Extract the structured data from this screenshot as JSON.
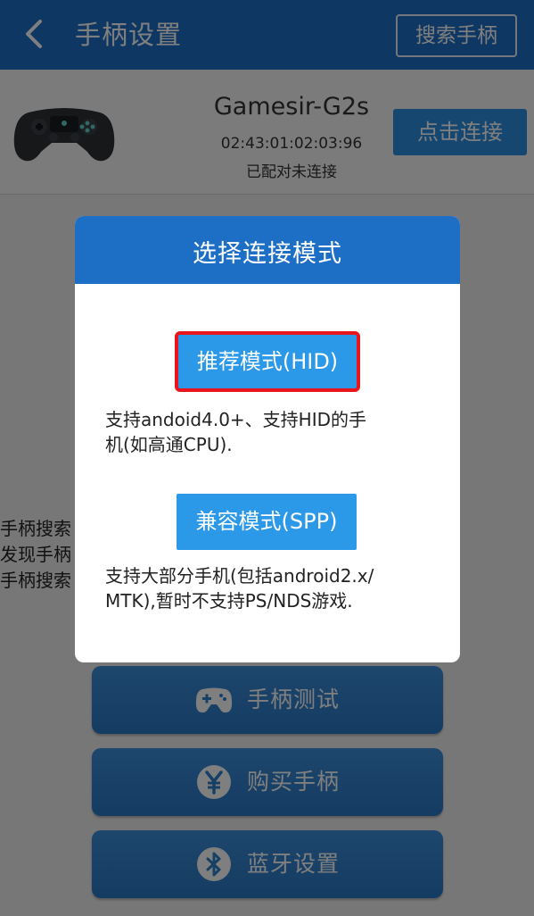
{
  "header": {
    "title": "手柄设置",
    "search_button": "搜索手柄"
  },
  "device": {
    "name": "Gamesir-G2s",
    "mac": "02:43:01:02:03:96",
    "status": "已配对未连接",
    "connect_button": "点击连接"
  },
  "background_text": {
    "line1": "手柄搜索",
    "line2": "发现手柄",
    "line3": "手柄搜索"
  },
  "menu": {
    "test": {
      "label": "手柄测试",
      "icon": "gamepad-icon"
    },
    "buy": {
      "label": "购买手柄",
      "icon": "yen-icon"
    },
    "bluetooth": {
      "label": "蓝牙设置",
      "icon": "bluetooth-icon"
    }
  },
  "dialog": {
    "title": "选择连接模式",
    "hid": {
      "label": "推荐模式(HID)",
      "description_line1": "支持andoid4.0+、支持HID的手",
      "description_line2": "机(如高通CPU)."
    },
    "spp": {
      "label": "兼容模式(SPP)",
      "description_line1": "支持大部分手机(包括android2.x/",
      "description_line2": "MTK),暂时不支持PS/NDS游戏."
    }
  },
  "colors": {
    "primary": "#1d6fc6",
    "button": "#2b98e8",
    "highlight": "#e8161c"
  }
}
